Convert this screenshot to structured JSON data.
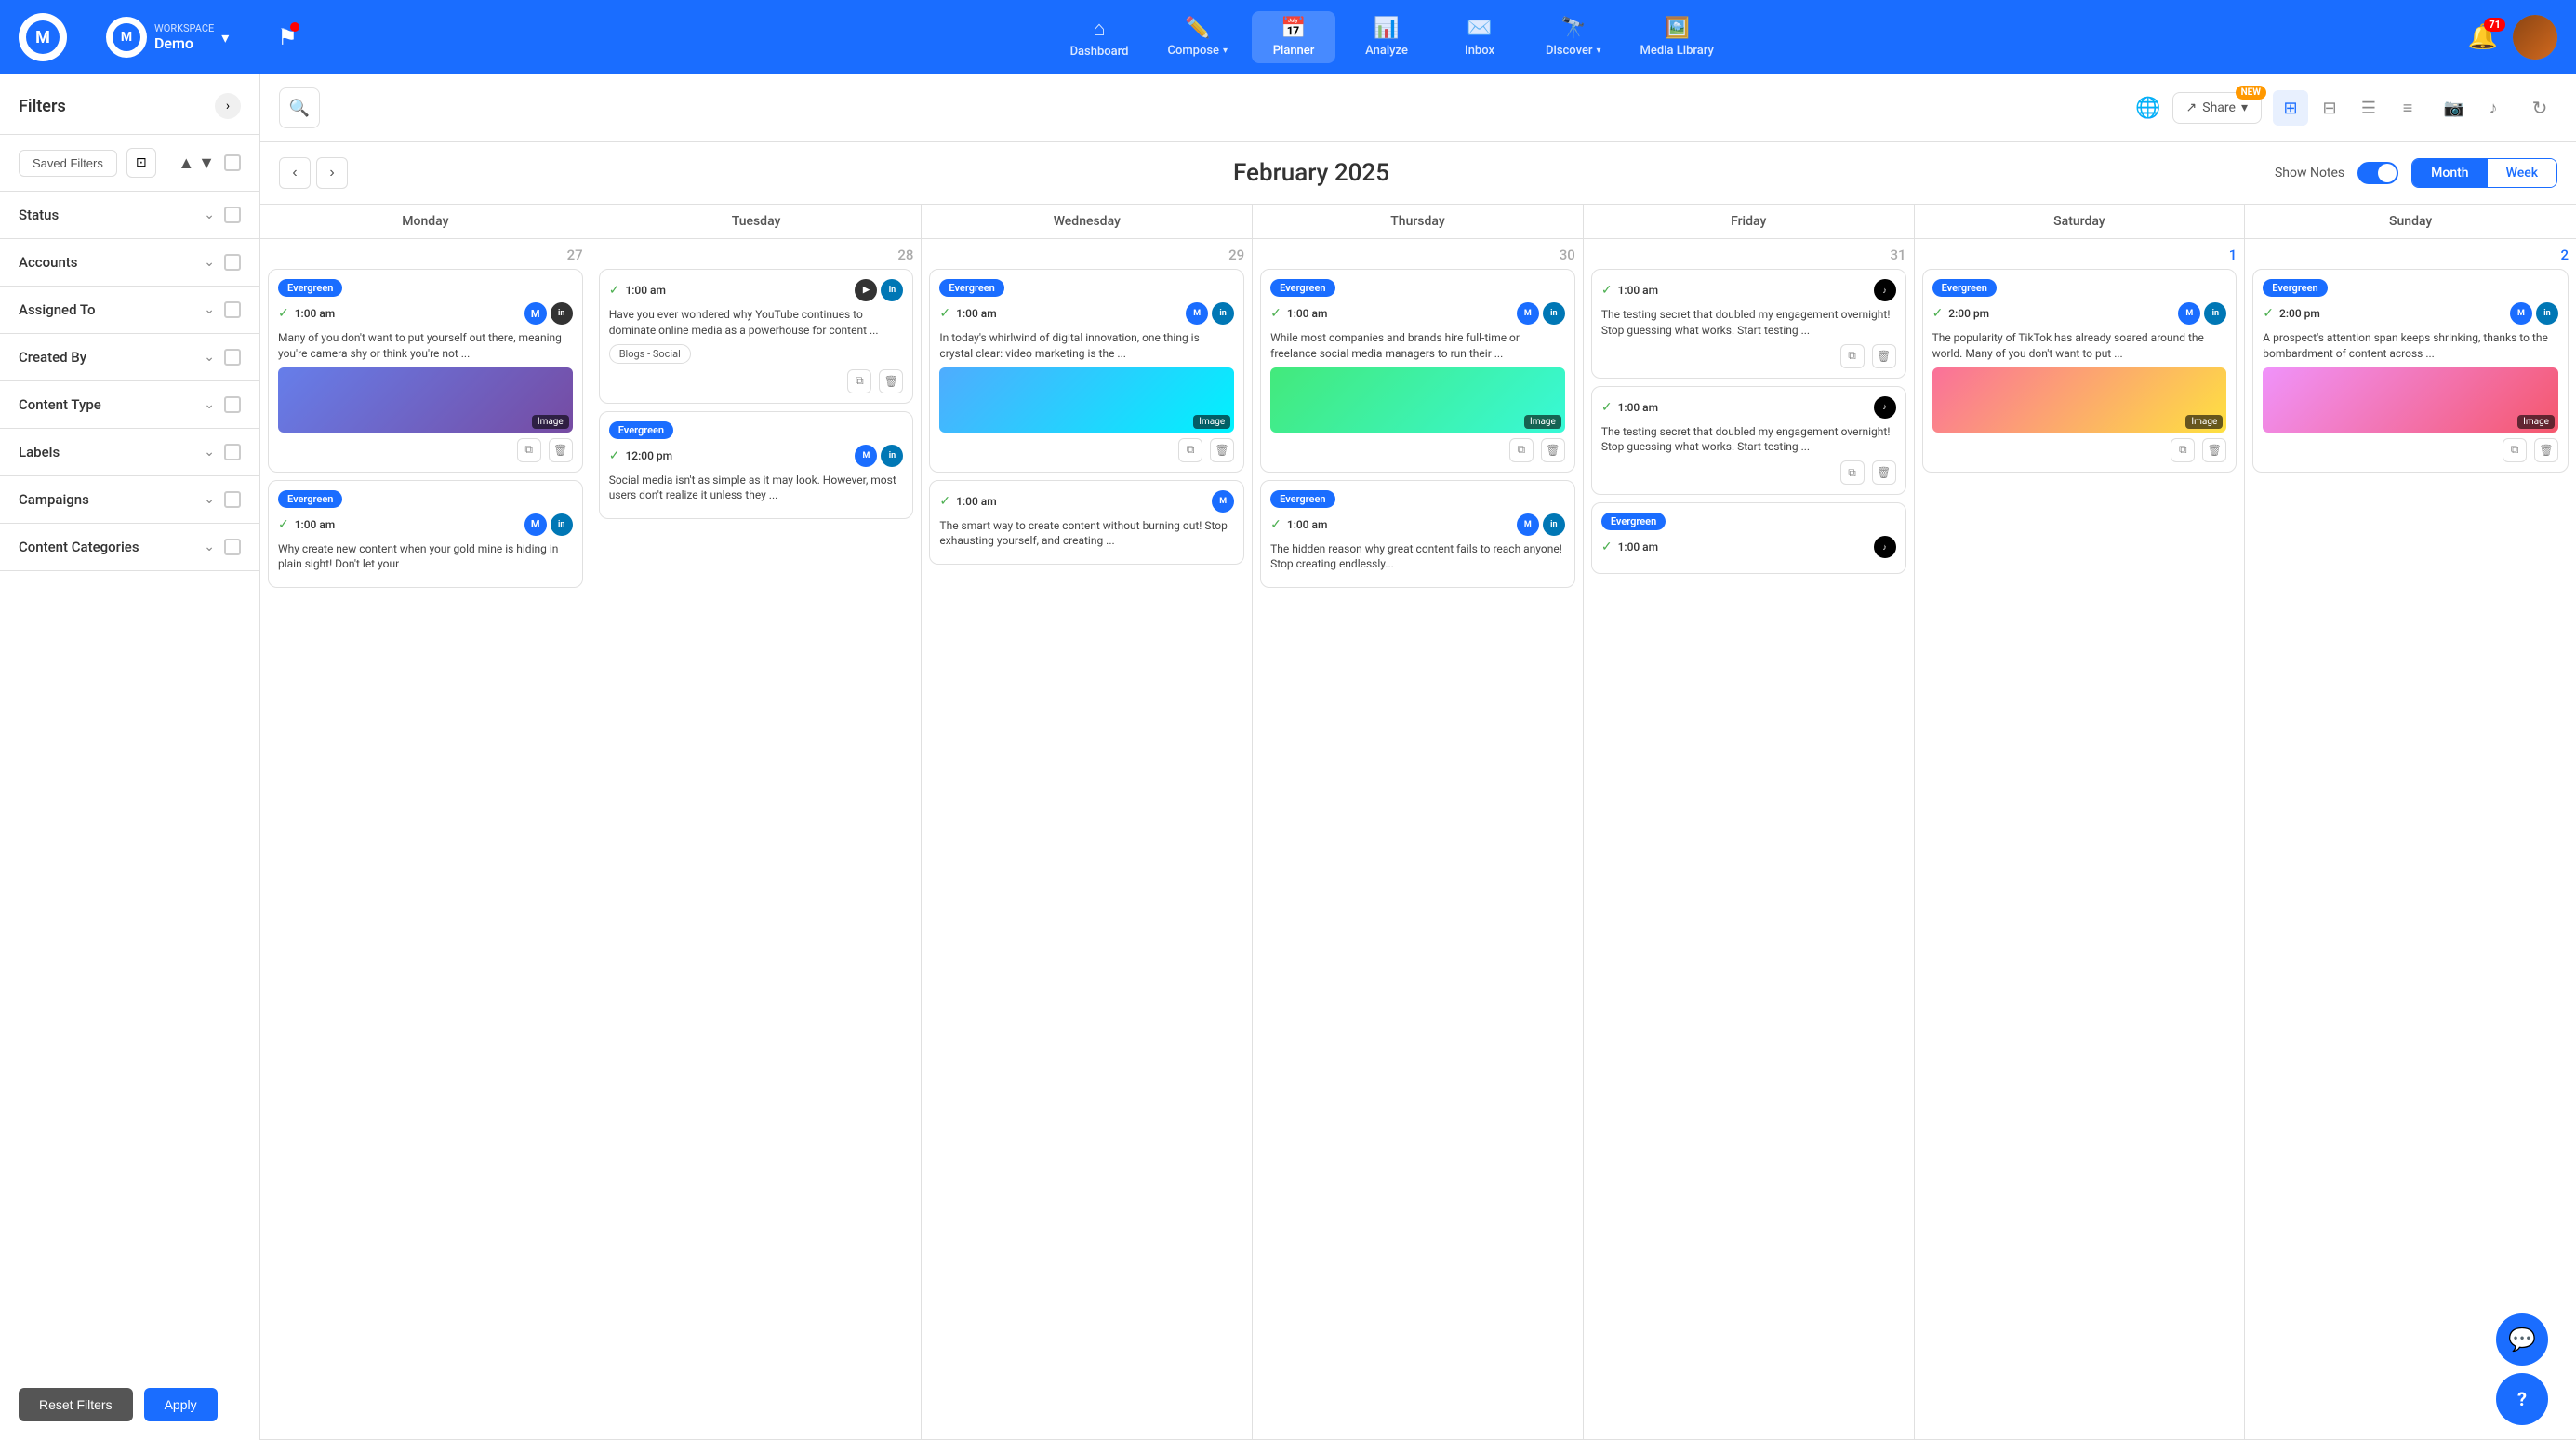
{
  "app": {
    "logo_text": "M"
  },
  "workspace": {
    "label": "WORKSPACE",
    "name": "Demo"
  },
  "nav": {
    "items": [
      {
        "id": "dashboard",
        "label": "Dashboard",
        "icon": "⌂"
      },
      {
        "id": "compose",
        "label": "Compose",
        "icon": "✏️",
        "has_dropdown": true
      },
      {
        "id": "planner",
        "label": "Planner",
        "icon": "📅",
        "active": true
      },
      {
        "id": "analyze",
        "label": "Analyze",
        "icon": "📊"
      },
      {
        "id": "inbox",
        "label": "Inbox",
        "icon": "✉️"
      },
      {
        "id": "discover",
        "label": "Discover",
        "icon": "🔭",
        "has_dropdown": true
      },
      {
        "id": "media-library",
        "label": "Media Library",
        "icon": "🖼️"
      }
    ],
    "notification_count": "71"
  },
  "sidebar": {
    "title": "Filters",
    "saved_filters_label": "Saved Filters",
    "filter_sections": [
      {
        "id": "status",
        "label": "Status"
      },
      {
        "id": "accounts",
        "label": "Accounts"
      },
      {
        "id": "assigned-to",
        "label": "Assigned To"
      },
      {
        "id": "created-by",
        "label": "Created By"
      },
      {
        "id": "content-type",
        "label": "Content Type"
      },
      {
        "id": "labels",
        "label": "Labels"
      },
      {
        "id": "campaigns",
        "label": "Campaigns"
      },
      {
        "id": "content-categories",
        "label": "Content Categories"
      }
    ],
    "reset_label": "Reset Filters",
    "apply_label": "Apply"
  },
  "calendar": {
    "title": "February 2025",
    "show_notes_label": "Show Notes",
    "month_tab": "Month",
    "week_tab": "Week",
    "days": [
      "Monday",
      "Tuesday",
      "Wednesday",
      "Thursday",
      "Friday",
      "Saturday",
      "Sunday"
    ],
    "cells": [
      {
        "date": "27",
        "other_month": true,
        "posts": [
          {
            "badge": "Evergreen",
            "time": "1:00 am",
            "text": "Many of you don't want to put yourself out there, meaning you're camera shy or think you're not ...",
            "has_image": true,
            "image_class": "mini-image-1",
            "image_label": "Image"
          },
          {
            "badge": "Evergreen",
            "time": "1:00 am",
            "text": "Why create new content when your gold mine is hiding in plain sight! Don't let your"
          }
        ]
      },
      {
        "date": "28",
        "other_month": true,
        "posts": [
          {
            "time": "1:00 am",
            "text": "Have you ever wondered why YouTube continues to dominate online media as a powerhouse for content ...",
            "has_tag": true,
            "tag_label": "Blogs - Social"
          },
          {
            "badge": "Evergreen",
            "time": "12:00 pm",
            "text": "Social media isn't as simple as it may look. However, most users don't realize it unless they ..."
          }
        ]
      },
      {
        "date": "29",
        "other_month": true,
        "posts": [
          {
            "badge": "Evergreen",
            "time": "1:00 am",
            "text": "In today's whirlwind of digital innovation, one thing is crystal clear: video marketing is the ...",
            "has_image": true,
            "image_class": "mini-image-3",
            "image_label": "Image"
          },
          {
            "time": "1:00 am",
            "text": "The smart way to create content without burning out! Stop exhausting yourself, and creating ..."
          }
        ]
      },
      {
        "date": "30",
        "other_month": true,
        "posts": [
          {
            "badge": "Evergreen",
            "time": "1:00 am",
            "text": "While most companies and brands hire full-time or freelance social media managers to run their ...",
            "has_image": true,
            "image_class": "mini-image-4",
            "image_label": "Image"
          },
          {
            "badge": "Evergreen",
            "time": "1:00 am",
            "text": "The hidden reason why great content fails to reach anyone! Stop creating endlessly..."
          }
        ]
      },
      {
        "date": "31",
        "other_month": true,
        "posts": [
          {
            "time": "1:00 am",
            "text": "The testing secret that doubled my engagement overnight! Stop guessing what works. Start testing ..."
          },
          {
            "time": "1:00 am",
            "text": "The testing secret that doubled my engagement overnight! Stop guessing what works. Start testing ..."
          },
          {
            "badge": "Evergreen",
            "time_placeholder": true
          }
        ]
      },
      {
        "date": "1",
        "future": true,
        "posts": [
          {
            "badge": "Evergreen",
            "time": "2:00 pm",
            "text": "The popularity of TikTok has already soared around the world. Many of you don't want to put ...",
            "has_image": true,
            "image_class": "mini-image-5",
            "image_label": "Image"
          }
        ]
      },
      {
        "date": "2",
        "future": true,
        "posts": [
          {
            "badge": "Evergreen",
            "time": "2:00 pm",
            "text": "A prospect's attention span keeps shrinking, thanks to the bombardment of content across ...",
            "has_image": true,
            "image_class": "mini-image-2",
            "image_label": "Image"
          }
        ]
      }
    ]
  },
  "icons": {
    "search": "🔍",
    "globe": "🌐",
    "share": "↗",
    "calendar_grid": "▦",
    "list_grid": "⊞",
    "list": "☰",
    "list_alt": "≡",
    "instagram": "📷",
    "tiktok": "♪",
    "refresh": "↻",
    "chevron_left": "‹",
    "chevron_right": "›",
    "chevron_down": "⌄",
    "chevron_up": "⌃",
    "collapse": "›",
    "check": "✓",
    "copy": "⧉",
    "delete": "🗑",
    "bell": "🔔",
    "chat": "💬",
    "help": "?"
  }
}
